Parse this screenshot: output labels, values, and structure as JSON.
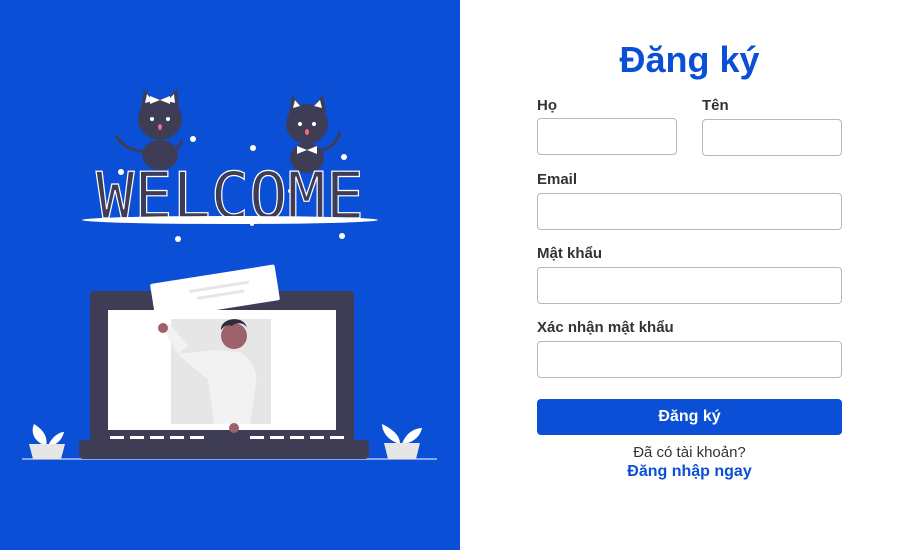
{
  "form": {
    "title": "Đăng ký",
    "first_name_label": "Họ",
    "last_name_label": "Tên",
    "email_label": "Email",
    "password_label": "Mật khẩu",
    "confirm_password_label": "Xác nhận mật khẩu",
    "first_name_value": "",
    "last_name_value": "",
    "email_value": "",
    "password_value": "",
    "confirm_password_value": "",
    "submit_label": "Đăng ký",
    "account_question": "Đã có tài khoản?",
    "login_link_label": "Đăng nhập ngay"
  },
  "illustration": {
    "welcome_text": "WELCOME",
    "icon": "welcome-illustration"
  },
  "colors": {
    "brand_blue": "#0a4fd6",
    "panel_background": "#ffffff",
    "text_dark": "#333333",
    "input_border": "#b8b8b8"
  }
}
